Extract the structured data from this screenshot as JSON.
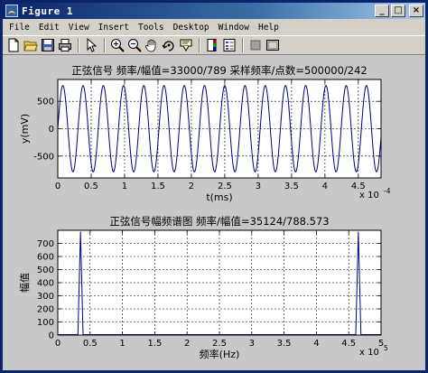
{
  "window": {
    "title": "Figure 1",
    "buttons": {
      "minimize": "_",
      "maximize": "□",
      "close": "×"
    }
  },
  "menubar": {
    "items": [
      "File",
      "Edit",
      "View",
      "Insert",
      "Tools",
      "Desktop",
      "Window",
      "Help"
    ]
  },
  "toolbar": {
    "tools": [
      "new-file-icon",
      "open-folder-icon",
      "save-icon",
      "print-icon",
      "pointer-icon",
      "zoom-in-icon",
      "zoom-out-icon",
      "pan-hand-icon",
      "rotate-3d-icon",
      "data-cursor-icon",
      "insert-colorbar-icon",
      "insert-legend-icon",
      "hide-plot-tools-icon",
      "show-plot-tools-icon"
    ]
  },
  "colors": {
    "line": "#000080",
    "axes_bg": "#ffffff",
    "figure_bg": "#c8c8c8"
  },
  "chart_data": [
    {
      "type": "line",
      "title": "正弦信号 频率/幅值=33000/789 采样频率/点数=500000/242",
      "xlabel": "t(ms)",
      "ylabel": "y(mV)",
      "x_exponent": "x 10",
      "x_exponent_power": "-4",
      "xlim": [
        0,
        4.84
      ],
      "ylim": [
        -900,
        900
      ],
      "xticks": [
        "0",
        "0.5",
        "1",
        "1.5",
        "2",
        "2.5",
        "3",
        "3.5",
        "4",
        "4.5"
      ],
      "xtick_values": [
        0,
        0.5,
        1,
        1.5,
        2,
        2.5,
        3,
        3.5,
        4,
        4.5
      ],
      "yticks": [
        "500",
        "0",
        "-500"
      ],
      "ytick_values": [
        500,
        0,
        -500
      ],
      "grid": true,
      "signal": {
        "frequency": 33000,
        "amplitude": 789,
        "sample_rate": 500000,
        "points": 242
      }
    },
    {
      "type": "line",
      "title": "正弦信号幅频谱图 频率/幅值=35124/788.573",
      "xlabel": "频率(Hz)",
      "ylabel": "幅值",
      "x_exponent": "x 10",
      "x_exponent_power": "5",
      "xlim": [
        0,
        5
      ],
      "ylim": [
        0,
        800
      ],
      "xticks": [
        "0",
        "0.5",
        "1",
        "1.5",
        "2",
        "2.5",
        "3",
        "3.5",
        "4",
        "4.5",
        "5"
      ],
      "xtick_values": [
        0,
        0.5,
        1,
        1.5,
        2,
        2.5,
        3,
        3.5,
        4,
        4.5,
        5
      ],
      "yticks": [
        "700",
        "600",
        "500",
        "400",
        "300",
        "200",
        "100",
        "0"
      ],
      "ytick_values": [
        700,
        600,
        500,
        400,
        300,
        200,
        100,
        0
      ],
      "grid": true,
      "peaks": [
        {
          "x": 0.35124,
          "y": 788.573
        },
        {
          "x": 4.64876,
          "y": 788.573
        }
      ]
    }
  ]
}
